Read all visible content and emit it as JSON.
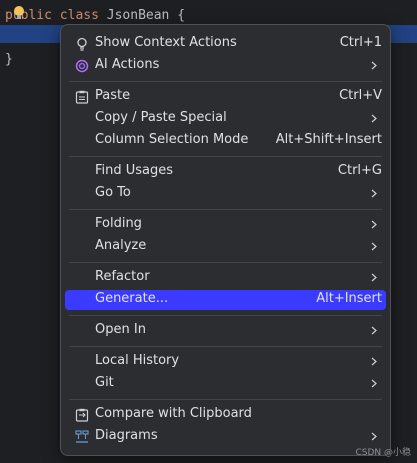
{
  "editor": {
    "line1": {
      "kw1": "public",
      "kw2": "class",
      "name": " JsonBean {"
    },
    "line3": "}"
  },
  "menu": {
    "items": [
      {
        "label": "Show Context Actions",
        "shortcut": "Ctrl+1",
        "icon": "lightbulb-icon"
      },
      {
        "label": "AI Actions",
        "icon": "ai-spiral-icon",
        "submenu": true
      },
      {
        "label": "Paste",
        "shortcut": "Ctrl+V",
        "icon": "clipboard-icon"
      },
      {
        "label": "Copy / Paste Special",
        "submenu": true
      },
      {
        "label": "Column Selection Mode",
        "shortcut": "Alt+Shift+Insert"
      },
      {
        "label": "Find Usages",
        "shortcut": "Ctrl+G"
      },
      {
        "label": "Go To",
        "submenu": true
      },
      {
        "label": "Folding",
        "submenu": true
      },
      {
        "label": "Analyze",
        "submenu": true
      },
      {
        "label": "Refactor",
        "submenu": true
      },
      {
        "label": "Generate...",
        "shortcut": "Alt+Insert",
        "selected": true
      },
      {
        "label": "Open In",
        "submenu": true
      },
      {
        "label": "Local History",
        "submenu": true
      },
      {
        "label": "Git",
        "submenu": true
      },
      {
        "label": "Compare with Clipboard",
        "icon": "compare-icon"
      },
      {
        "label": "Diagrams",
        "icon": "diagram-icon",
        "submenu": true
      }
    ]
  },
  "watermark": "CSDN @小稳",
  "colors": {
    "selection": "#3b3bff",
    "keyword": "#cf8e6d",
    "menu_bg": "#2b2d30"
  }
}
